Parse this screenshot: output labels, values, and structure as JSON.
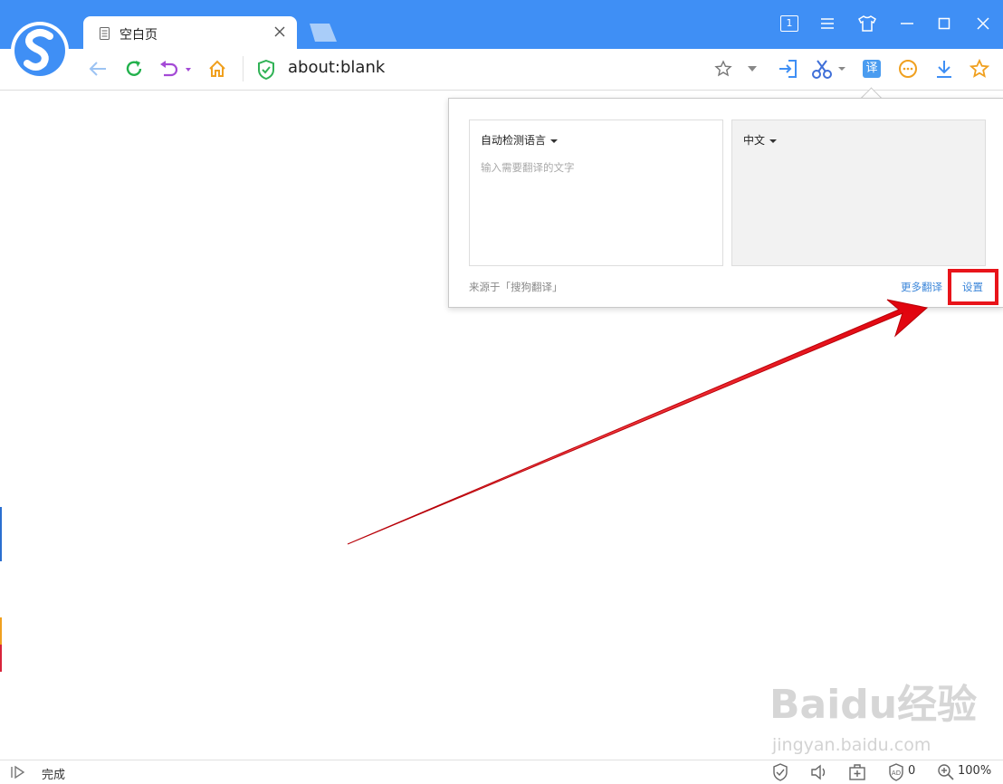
{
  "browser": {
    "tab_title": "空白页",
    "url": "about:blank",
    "tab_counter": "1",
    "status_text": "完成",
    "ad_count": "0",
    "zoom": "100%"
  },
  "translate_panel": {
    "source_language": "自动检测语言",
    "target_language": "中文",
    "input_placeholder": "输入需要翻译的文字",
    "source_note": "来源于「搜狗翻译」",
    "more_translate": "更多翻译",
    "settings": "设置"
  },
  "watermark": {
    "brand": "Baidu经验",
    "site": "jingyan.baidu.com"
  },
  "colors": {
    "titlebar": "#3f8ff5",
    "highlight": "#e8141a",
    "link": "#3b86d9"
  }
}
